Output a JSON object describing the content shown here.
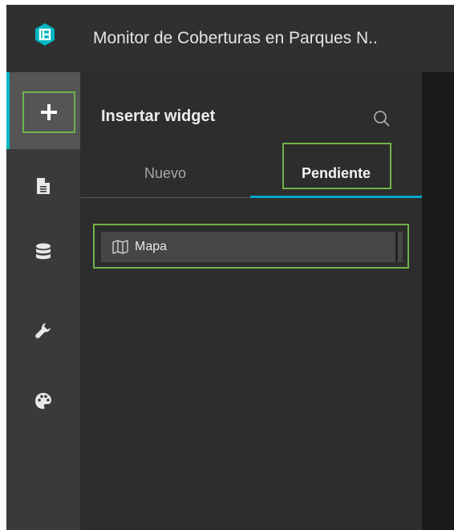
{
  "header": {
    "app_title": "Monitor de Coberturas en Parques N..",
    "logo_icon": "app-logo-icon"
  },
  "toolbar": {
    "items": [
      {
        "name": "insert",
        "icon": "plus-icon",
        "active": true
      },
      {
        "name": "page",
        "icon": "document-icon"
      },
      {
        "name": "data",
        "icon": "database-icon"
      },
      {
        "name": "settings",
        "icon": "wrench-icon"
      },
      {
        "name": "theme",
        "icon": "palette-icon"
      }
    ]
  },
  "panel": {
    "title": "Insertar widget",
    "search_icon": "search-icon",
    "tabs": [
      {
        "label": "Nuevo",
        "active": false
      },
      {
        "label": "Pendiente",
        "active": true
      }
    ],
    "widgets": [
      {
        "label": "Mapa",
        "icon": "map-icon"
      }
    ]
  },
  "colors": {
    "accent": "#00b7c3",
    "highlight_box": "#6fb34a",
    "tab_underline": "#00a7c8"
  }
}
